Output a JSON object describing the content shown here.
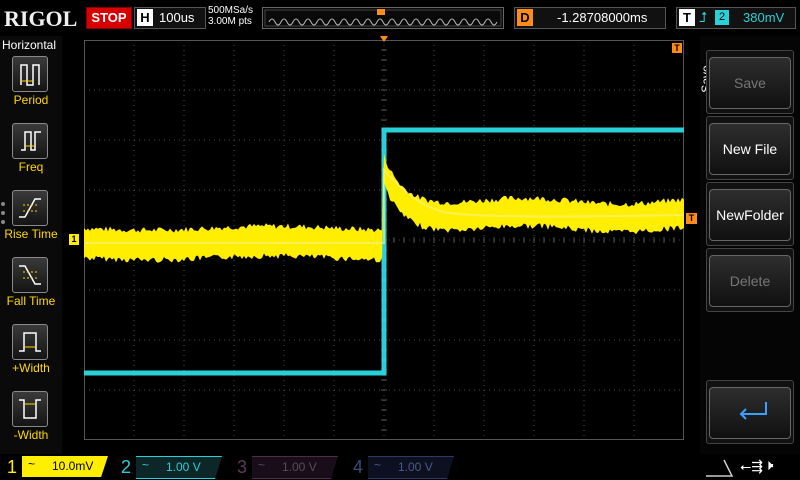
{
  "header": {
    "brand": "RIGOL",
    "run_state": "STOP",
    "timebase_label": "H",
    "timebase_value": "100us",
    "sample_rate": "500MSa/s",
    "memory_depth": "3.00M pts",
    "delay_label": "D",
    "delay_value": "-1.28708000ms",
    "trigger_label": "T",
    "trigger_edge": "rising-edge-icon",
    "trigger_source": "2",
    "trigger_level": "380mV"
  },
  "left_panel": {
    "title": "Horizontal",
    "items": [
      {
        "label": "Period",
        "icon": "period-icon"
      },
      {
        "label": "Freq",
        "icon": "frequency-icon"
      },
      {
        "label": "Rise Time",
        "icon": "rise-time-icon"
      },
      {
        "label": "Fall Time",
        "icon": "fall-time-icon"
      },
      {
        "label": "+Width",
        "icon": "positive-width-icon"
      },
      {
        "label": "-Width",
        "icon": "negative-width-icon"
      }
    ]
  },
  "right_menu": {
    "title": "Save",
    "buttons": [
      {
        "label": "Save",
        "enabled": false
      },
      {
        "label": "New File",
        "enabled": true
      },
      {
        "label": "NewFolder",
        "enabled": true
      },
      {
        "label": "Delete",
        "enabled": false
      },
      {
        "label": "",
        "icon": "enter-icon",
        "enabled": true
      }
    ]
  },
  "channels": [
    {
      "number": "1",
      "coupling": "~",
      "scale": "10.0mV",
      "active": true,
      "color": "#ffee00"
    },
    {
      "number": "2",
      "coupling": "~",
      "scale": "1.00 V",
      "active": true,
      "color": "#2ad0d8"
    },
    {
      "number": "3",
      "coupling": "~",
      "scale": "1.00 V",
      "active": false,
      "color": "#5c3a5c"
    },
    {
      "number": "4",
      "coupling": "~",
      "scale": "1.00 V",
      "active": false,
      "color": "#3c4a7a"
    }
  ],
  "markers": {
    "ch1": "1",
    "trigger_level": "T",
    "trigger_position": "T"
  },
  "status_icons": [
    "usb-icon",
    "mute-icon"
  ],
  "colors": {
    "ch1": "#ffee00",
    "ch2": "#2ad0d8",
    "trigger": "#ff8c1a",
    "stop": "#d60000"
  }
}
